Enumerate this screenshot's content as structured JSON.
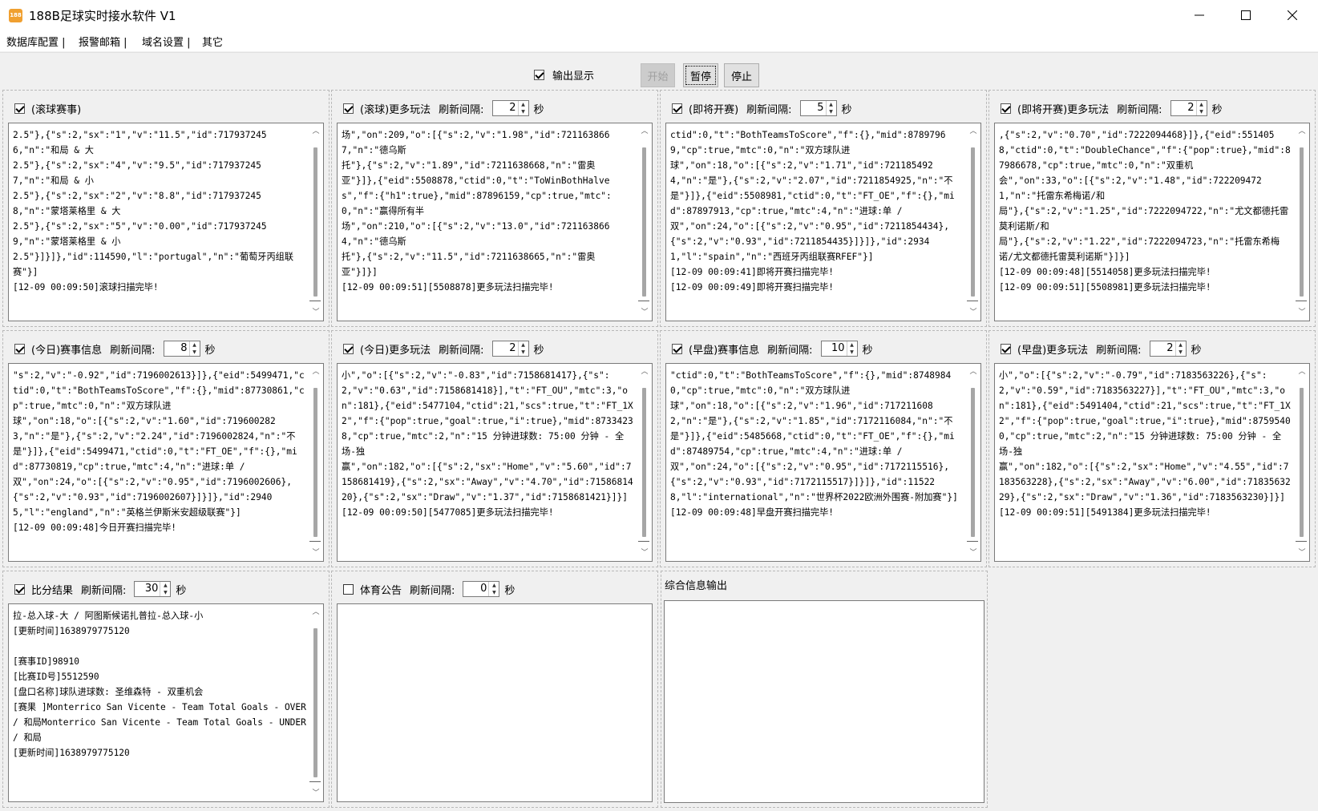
{
  "window": {
    "title": "188B足球实时接水软件 V1",
    "icon_text": "188",
    "icon_color": "#f0a030"
  },
  "menu": [
    "数据库配置 |",
    "报警邮箱 |",
    "域名设置 |",
    "其它"
  ],
  "controls": {
    "output_label": "输出显示",
    "output_checked": true,
    "start": "开始",
    "pause": "暂停",
    "stop": "停止"
  },
  "common": {
    "interval_label": "刷新间隔:",
    "sec": "秒"
  },
  "panels": [
    {
      "title": "(滚球赛事)",
      "checked": true,
      "has_interval": false,
      "interval": "",
      "text": "2.5\"},{\"s\":2,\"sx\":\"1\",\"v\":\"11.5\",\"id\":7179372456,\"n\":\"和局 & 大\n2.5\"},{\"s\":2,\"sx\":\"4\",\"v\":\"9.5\",\"id\":7179372457,\"n\":\"和局 & 小\n2.5\"},{\"s\":2,\"sx\":\"2\",\"v\":\"8.8\",\"id\":7179372458,\"n\":\"蒙塔莱格里 & 大\n2.5\"},{\"s\":2,\"sx\":\"5\",\"v\":\"0.00\",\"id\":7179372459,\"n\":\"蒙塔莱格里 & 小\n2.5\"}]}]},\"id\":114590,\"l\":\"portugal\",\"n\":\"葡萄牙丙组联赛\"}]\n[12-09 00:09:50]滚球扫描完毕!"
    },
    {
      "title": "(滚球)更多玩法",
      "checked": true,
      "has_interval": true,
      "interval": "2",
      "text": "场\",\"on\":209,\"o\":[{\"s\":2,\"v\":\"1.98\",\"id\":7211638667,\"n\":\"德乌斯\n托\"},{\"s\":2,\"v\":\"1.89\",\"id\":7211638668,\"n\":\"雷奥\n亚\"}]},{\"eid\":5508878,\"ctid\":0,\"t\":\"ToWinBothHalves\",\"f\":{\"h1\":true},\"mid\":87896159,\"cp\":true,\"mtc\":0,\"n\":\"赢得所有半\n场\",\"on\":210,\"o\":[{\"s\":2,\"v\":\"13.0\",\"id\":7211638664,\"n\":\"德乌斯\n托\"},{\"s\":2,\"v\":\"11.5\",\"id\":7211638665,\"n\":\"雷奥\n亚\"}]}]\n[12-09 00:09:51][5508878]更多玩法扫描完毕!"
    },
    {
      "title": "(即将开赛)",
      "checked": true,
      "has_interval": true,
      "interval": "5",
      "text": "ctid\":0,\"t\":\"BothTeamsToScore\",\"f\":{},\"mid\":87897969,\"cp\":true,\"mtc\":0,\"n\":\"双方球队进\n球\",\"on\":18,\"o\":[{\"s\":2,\"v\":\"1.71\",\"id\":7211854924,\"n\":\"是\"},{\"s\":2,\"v\":\"2.07\",\"id\":7211854925,\"n\":\"不\n是\"}]},{\"eid\":5508981,\"ctid\":0,\"t\":\"FT_OE\",\"f\":{},\"mid\":87897913,\"cp\":true,\"mtc\":4,\"n\":\"进球:单 /\n双\",\"on\":24,\"o\":[{\"s\":2,\"v\":\"0.95\",\"id\":7211854434},{\"s\":2,\"v\":\"0.93\",\"id\":7211854435}]}]},\"id\":29341,\"l\":\"spain\",\"n\":\"西班牙丙组联赛RFEF\"}]\n[12-09 00:09:41]即将开赛扫描完毕!\n[12-09 00:09:49]即将开赛扫描完毕!"
    },
    {
      "title": "(即将开赛)更多玩法",
      "checked": true,
      "has_interval": true,
      "interval": "2",
      "text": ",{\"s\":2,\"v\":\"0.70\",\"id\":7222094468}]},{\"eid\":5514058,\"ctid\":0,\"t\":\"DoubleChance\",\"f\":{\"pop\":true},\"mid\":87986678,\"cp\":true,\"mtc\":0,\"n\":\"双重机\n会\",\"on\":33,\"o\":[{\"s\":2,\"v\":\"1.48\",\"id\":7222094721,\"n\":\"托雷东希梅诺/和\n局\"},{\"s\":2,\"v\":\"1.25\",\"id\":7222094722,\"n\":\"尤文都德托雷莫利诺斯/和\n局\"},{\"s\":2,\"v\":\"1.22\",\"id\":7222094723,\"n\":\"托雷东希梅诺/尤文都德托雷莫利诺斯\"}]}]\n[12-09 00:09:48][5514058]更多玩法扫描完毕!\n[12-09 00:09:51][5508981]更多玩法扫描完毕!"
    },
    {
      "title": "(今日)赛事信息",
      "checked": true,
      "has_interval": true,
      "interval": "8",
      "text": "\"s\":2,\"v\":\"-0.92\",\"id\":7196002613}]},{\"eid\":5499471,\"ctid\":0,\"t\":\"BothTeamsToScore\",\"f\":{},\"mid\":87730861,\"cp\":true,\"mtc\":0,\"n\":\"双方球队进\n球\",\"on\":18,\"o\":[{\"s\":2,\"v\":\"1.60\",\"id\":7196002823,\"n\":\"是\"},{\"s\":2,\"v\":\"2.24\",\"id\":7196002824,\"n\":\"不\n是\"}]},{\"eid\":5499471,\"ctid\":0,\"t\":\"FT_OE\",\"f\":{},\"mid\":87730819,\"cp\":true,\"mtc\":4,\"n\":\"进球:单 /\n双\",\"on\":24,\"o\":[{\"s\":2,\"v\":\"0.95\",\"id\":7196002606},{\"s\":2,\"v\":\"0.93\",\"id\":7196002607}]}]},\"id\":29405,\"l\":\"england\",\"n\":\"英格兰伊斯米安超级联赛\"}]\n[12-09 00:09:48]今日开赛扫描完毕!"
    },
    {
      "title": "(今日)更多玩法",
      "checked": true,
      "has_interval": true,
      "interval": "2",
      "text": "小\",\"o\":[{\"s\":2,\"v\":\"-0.83\",\"id\":7158681417},{\"s\":2,\"v\":\"0.63\",\"id\":7158681418}],\"t\":\"FT_OU\",\"mtc\":3,\"on\":181},{\"eid\":5477104,\"ctid\":21,\"scs\":true,\"t\":\"FT_1X2\",\"f\":{\"pop\":true,\"goal\":true,\"i\":true},\"mid\":87334238,\"cp\":true,\"mtc\":2,\"n\":\"15 分钟进球数: 75:00 分钟 - 全场-独\n赢\",\"on\":182,\"o\":[{\"s\":2,\"sx\":\"Home\",\"v\":\"5.60\",\"id\":7158681419},{\"s\":2,\"sx\":\"Away\",\"v\":\"4.70\",\"id\":7158681420},{\"s\":2,\"sx\":\"Draw\",\"v\":\"1.37\",\"id\":7158681421}]}]\n[12-09 00:09:50][5477085]更多玩法扫描完毕!"
    },
    {
      "title": "(早盘)赛事信息",
      "checked": true,
      "has_interval": true,
      "interval": "10",
      "text": "\"ctid\":0,\"t\":\"BothTeamsToScore\",\"f\":{},\"mid\":87489840,\"cp\":true,\"mtc\":0,\"n\":\"双方球队进\n球\",\"on\":18,\"o\":[{\"s\":2,\"v\":\"1.96\",\"id\":7172116082,\"n\":\"是\"},{\"s\":2,\"v\":\"1.85\",\"id\":7172116084,\"n\":\"不\n是\"}]},{\"eid\":5485668,\"ctid\":0,\"t\":\"FT_OE\",\"f\":{},\"mid\":87489754,\"cp\":true,\"mtc\":4,\"n\":\"进球:单 /\n双\",\"on\":24,\"o\":[{\"s\":2,\"v\":\"0.95\",\"id\":7172115516},{\"s\":2,\"v\":\"0.93\",\"id\":7172115517}]}]},\"id\":115228,\"l\":\"international\",\"n\":\"世界杯2022欧洲外围赛-附加赛\"}]\n[12-09 00:09:48]早盘开赛扫描完毕!"
    },
    {
      "title": "(早盘)更多玩法",
      "checked": true,
      "has_interval": true,
      "interval": "2",
      "text": "小\",\"o\":[{\"s\":2,\"v\":\"-0.79\",\"id\":7183563226},{\"s\":2,\"v\":\"0.59\",\"id\":7183563227}],\"t\":\"FT_OU\",\"mtc\":3,\"on\":181},{\"eid\":5491404,\"ctid\":21,\"scs\":true,\"t\":\"FT_1X2\",\"f\":{\"pop\":true,\"goal\":true,\"i\":true},\"mid\":87595400,\"cp\":true,\"mtc\":2,\"n\":\"15 分钟进球数: 75:00 分钟 - 全场-独\n赢\",\"on\":182,\"o\":[{\"s\":2,\"sx\":\"Home\",\"v\":\"4.55\",\"id\":7183563228},{\"s\":2,\"sx\":\"Away\",\"v\":\"6.00\",\"id\":7183563229},{\"s\":2,\"sx\":\"Draw\",\"v\":\"1.36\",\"id\":7183563230}]}]\n[12-09 00:09:51][5491384]更多玩法扫描完毕!"
    },
    {
      "title": "比分结果",
      "checked": true,
      "has_interval": true,
      "interval": "30",
      "text": "拉-总入球-大 / 阿图斯候诺扎普拉-总入球-小\n[更新时间]1638979775120\n\n[赛事ID]98910\n[比赛ID号]5512590\n[盘口名称]球队进球数: 圣维森特 - 双重机会\n[赛果 ]Monterrico San Vicente - Team Total Goals - OVER / 和局Monterrico San Vicente - Team Total Goals - UNDER / 和局\n[更新时间]1638979775120"
    },
    {
      "title": "体育公告",
      "checked": false,
      "has_interval": true,
      "interval": "0",
      "text": ""
    }
  ],
  "summary": {
    "title": "综合信息输出",
    "text": ""
  }
}
